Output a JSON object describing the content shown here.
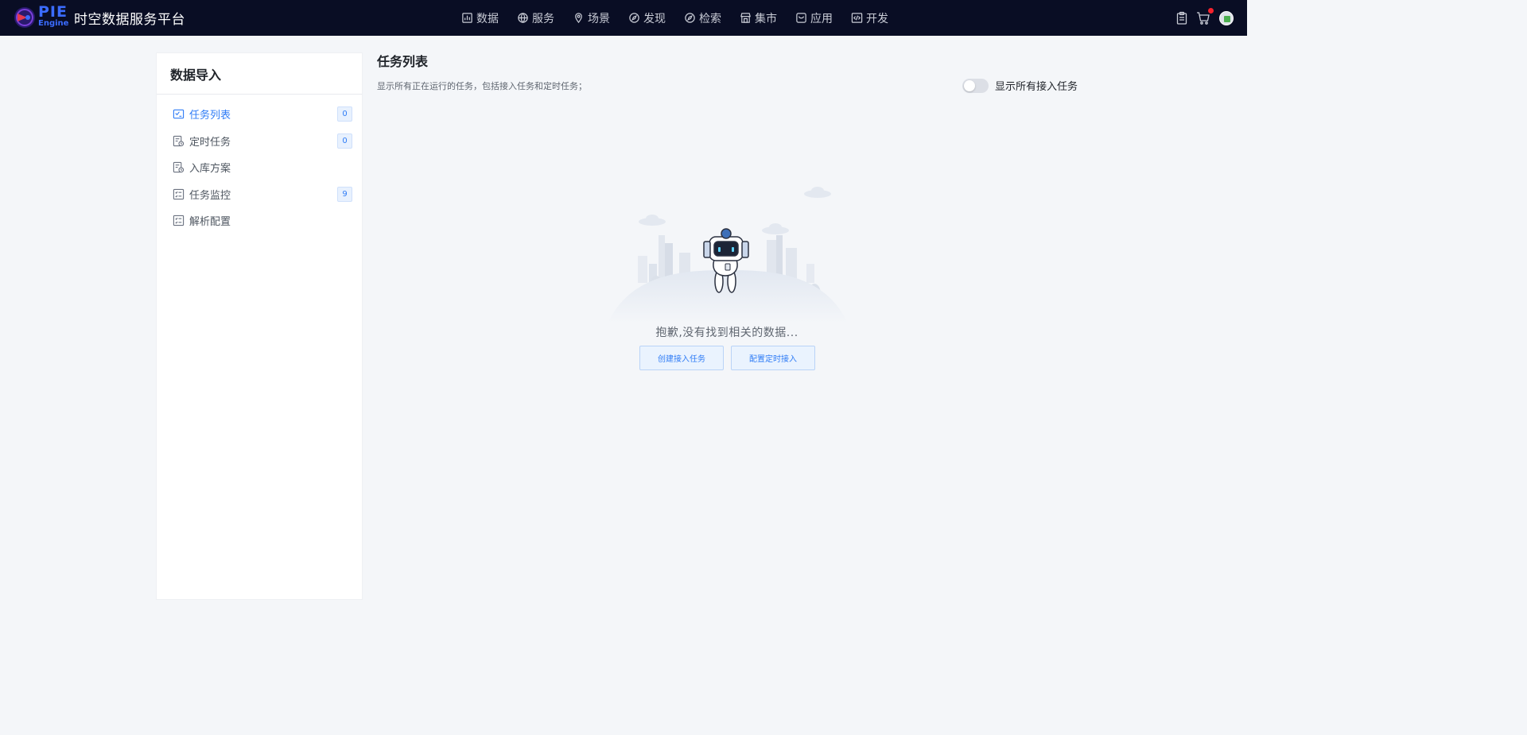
{
  "app": {
    "title": "时空数据服务平台",
    "logo_top": "PIE",
    "logo_bottom": "Engine"
  },
  "nav": {
    "items": [
      {
        "label": "数据",
        "icon": "bar-chart-icon"
      },
      {
        "label": "服务",
        "icon": "globe-icon"
      },
      {
        "label": "场景",
        "icon": "location-pin-icon"
      },
      {
        "label": "发现",
        "icon": "compass-icon"
      },
      {
        "label": "检索",
        "icon": "search-compass-icon"
      },
      {
        "label": "集市",
        "icon": "store-icon"
      },
      {
        "label": "应用",
        "icon": "app-icon"
      },
      {
        "label": "开发",
        "icon": "code-icon"
      }
    ]
  },
  "top_right": {
    "icons": [
      "clipboard-icon",
      "cart-icon",
      "avatar"
    ],
    "cart_has_notification": true
  },
  "sidebar": {
    "title": "数据导入",
    "items": [
      {
        "label": "任务列表",
        "badge": "0",
        "active": true,
        "icon": "task-list-icon"
      },
      {
        "label": "定时任务",
        "badge": "0",
        "active": false,
        "icon": "scheduled-task-icon"
      },
      {
        "label": "入库方案",
        "badge": "",
        "active": false,
        "icon": "storage-plan-icon"
      },
      {
        "label": "任务监控",
        "badge": "9",
        "active": false,
        "icon": "task-monitor-icon"
      },
      {
        "label": "解析配置",
        "badge": "",
        "active": false,
        "icon": "parse-config-icon"
      }
    ]
  },
  "main": {
    "title": "任务列表",
    "description": "显示所有正在运行的任务，包括接入任务和定时任务；",
    "toggle": {
      "label": "显示所有接入任务",
      "on": false
    },
    "empty": {
      "message": "抱歉,没有找到相关的数据...",
      "buttons": [
        "创建接入任务",
        "配置定时接入"
      ]
    }
  },
  "colors": {
    "topbar_bg": "#090d24",
    "accent": "#2f7cf6",
    "page_bg": "#f4f6f9"
  }
}
